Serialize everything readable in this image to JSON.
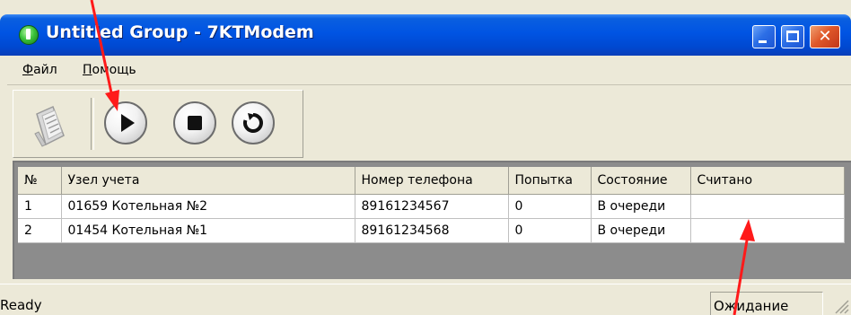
{
  "window": {
    "title": "Untitled Group - 7KTModem",
    "app_icon": "green-app-icon",
    "caption_buttons": [
      "minimize",
      "maximize",
      "close"
    ],
    "title_color": "#0054e3",
    "close_color": "#e0582a"
  },
  "menu": {
    "items": [
      {
        "label": "Файл"
      },
      {
        "label": "Помощь"
      }
    ]
  },
  "toolbar": {
    "buttons": [
      {
        "icon": "document-icon",
        "enabled": false
      },
      {
        "icon": "play-icon"
      },
      {
        "icon": "stop-icon"
      },
      {
        "icon": "refresh-icon"
      }
    ]
  },
  "table": {
    "columns": [
      "№",
      "Узел учета",
      "Номер телефона",
      "Попытка",
      "Состояние",
      "Считано"
    ],
    "rows": [
      {
        "num": "1",
        "node": "01659 Котельная №2",
        "phone": "89161234567",
        "attempt": "0",
        "state": "В очереди",
        "read": ""
      },
      {
        "num": "2",
        "node": "01454 Котельная №1",
        "phone": "89161234568",
        "attempt": "0",
        "state": "В очереди",
        "read": ""
      }
    ]
  },
  "status": {
    "left": "Ready",
    "panel": "Ожидание"
  },
  "annotations": {
    "arrow_color": "#ff1a1a"
  }
}
